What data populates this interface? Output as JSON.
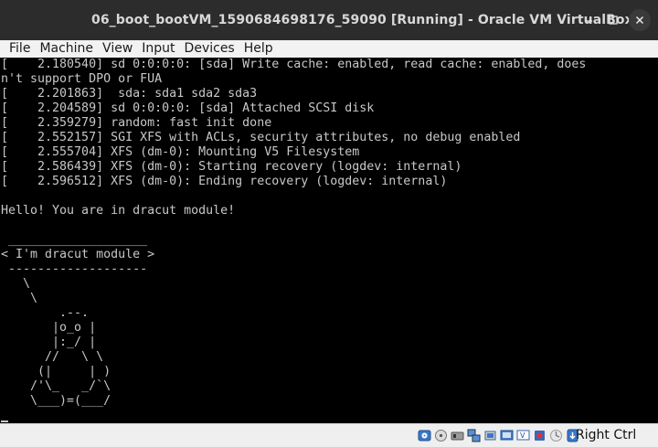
{
  "window": {
    "title": "06_boot_bootVM_1590684698176_59090 [Running] - Oracle VM VirtualBox",
    "controls": {
      "minimize": "–",
      "maximize": "□",
      "close": "✕"
    }
  },
  "menubar": {
    "items": [
      "File",
      "Machine",
      "View",
      "Input",
      "Devices",
      "Help"
    ]
  },
  "console": {
    "lines": [
      "[    2.180540] sd 0:0:0:0: [sda] Write cache: enabled, read cache: enabled, does",
      "n't support DPO or FUA",
      "[    2.201863]  sda: sda1 sda2 sda3",
      "[    2.204589] sd 0:0:0:0: [sda] Attached SCSI disk",
      "[    2.359279] random: fast init done",
      "[    2.552157] SGI XFS with ACLs, security attributes, no debug enabled",
      "[    2.555704] XFS (dm-0): Mounting V5 Filesystem",
      "[    2.586439] XFS (dm-0): Starting recovery (logdev: internal)",
      "[    2.596512] XFS (dm-0): Ending recovery (logdev: internal)",
      "",
      "Hello! You are in dracut module!",
      "",
      " ___________________",
      "< I'm dracut module >",
      " -------------------",
      "   \\",
      "    \\",
      "        .--.",
      "       |o_o |",
      "       |:_/ |",
      "      //   \\ \\",
      "     (|     | )",
      "    /'\\_   _/`\\",
      "    \\___)=(___/"
    ]
  },
  "statusbar": {
    "icons": [
      "hard-disk-icon",
      "optical-drive-icon",
      "audio-icon",
      "network-icon",
      "usb-icon",
      "shared-folders-icon",
      "display-icon",
      "video-capture-icon",
      "cpu-icon",
      "mouse-integration-icon"
    ],
    "host_key": "Right Ctrl"
  },
  "colors": {
    "titlebar_bg": "#2c2c2c",
    "menubar_bg": "#f2f2f2",
    "console_bg": "#000000",
    "console_fg": "#c8c8c8",
    "statusbar_bg": "#efefef"
  }
}
